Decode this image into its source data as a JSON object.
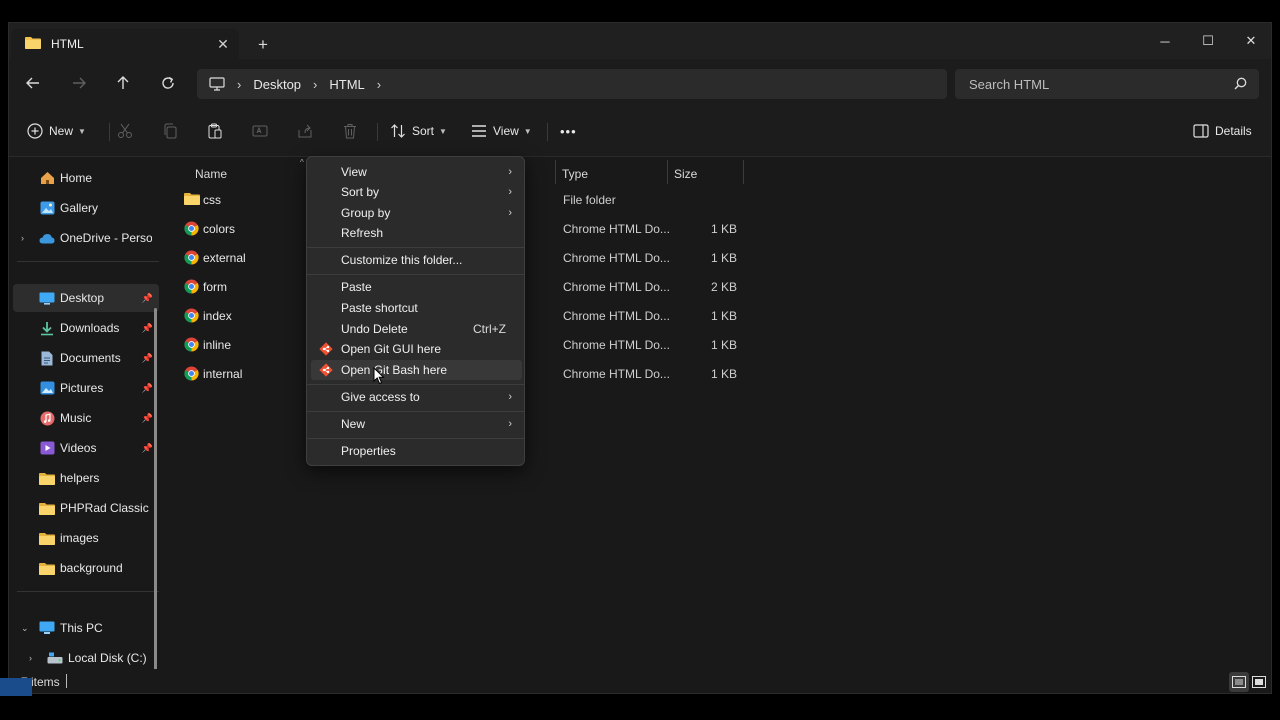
{
  "window": {
    "tab_title": "HTML",
    "tab_close": "✕",
    "new_tab": "+"
  },
  "window_controls": {
    "minimize": "─",
    "maximize": "☐",
    "close": "✕"
  },
  "address": {
    "breadcrumbs": [
      "Desktop",
      "HTML"
    ],
    "search_placeholder": "Search HTML"
  },
  "commands": {
    "new_label": "New",
    "sort_label": "Sort",
    "view_label": "View",
    "more_label": "•••",
    "details_label": "Details"
  },
  "sidebar": {
    "items": [
      {
        "label": "Home",
        "icon": "home-icon"
      },
      {
        "label": "Gallery",
        "icon": "gallery-icon"
      },
      {
        "label": "OneDrive - Persor",
        "icon": "cloud-icon"
      },
      {
        "label": "Desktop",
        "icon": "desktop-icon",
        "pinned": true,
        "active": true
      },
      {
        "label": "Downloads",
        "icon": "download-icon",
        "pinned": true
      },
      {
        "label": "Documents",
        "icon": "document-icon",
        "pinned": true
      },
      {
        "label": "Pictures",
        "icon": "pictures-icon",
        "pinned": true
      },
      {
        "label": "Music",
        "icon": "music-icon",
        "pinned": true
      },
      {
        "label": "Videos",
        "icon": "videos-icon",
        "pinned": true
      },
      {
        "label": "helpers",
        "icon": "folder-icon"
      },
      {
        "label": "PHPRad Classic P",
        "icon": "folder-icon"
      },
      {
        "label": "images",
        "icon": "folder-icon"
      },
      {
        "label": "background",
        "icon": "folder-icon"
      },
      {
        "label": "This PC",
        "icon": "pc-icon"
      },
      {
        "label": "Local Disk (C:)",
        "icon": "disk-icon"
      }
    ]
  },
  "columns": {
    "name": "Name",
    "type": "Type",
    "size": "Size"
  },
  "files": [
    {
      "name": "css",
      "type": "File folder",
      "size": "",
      "kind": "folder"
    },
    {
      "name": "colors",
      "type": "Chrome HTML Do...",
      "size": "1 KB",
      "kind": "chrome"
    },
    {
      "name": "external",
      "type": "Chrome HTML Do...",
      "size": "1 KB",
      "kind": "chrome"
    },
    {
      "name": "form",
      "type": "Chrome HTML Do...",
      "size": "2 KB",
      "kind": "chrome"
    },
    {
      "name": "index",
      "type": "Chrome HTML Do...",
      "size": "1 KB",
      "kind": "chrome"
    },
    {
      "name": "inline",
      "type": "Chrome HTML Do...",
      "size": "1 KB",
      "kind": "chrome"
    },
    {
      "name": "internal",
      "type": "Chrome HTML Do...",
      "size": "1 KB",
      "kind": "chrome"
    }
  ],
  "status": {
    "items_count": "7 items"
  },
  "context_menu": {
    "view": "View",
    "sort_by": "Sort by",
    "group_by": "Group by",
    "refresh": "Refresh",
    "customize": "Customize this folder...",
    "paste": "Paste",
    "paste_shortcut": "Paste shortcut",
    "undo_delete": "Undo Delete",
    "undo_delete_key": "Ctrl+Z",
    "git_gui": "Open Git GUI here",
    "git_bash": "Open Git Bash here",
    "give_access": "Give access to",
    "new": "New",
    "properties": "Properties",
    "submenu_arrow": "›"
  },
  "colors": {
    "folder": "#f2c14e",
    "accent": "#60cdff",
    "git": "#f05033"
  }
}
